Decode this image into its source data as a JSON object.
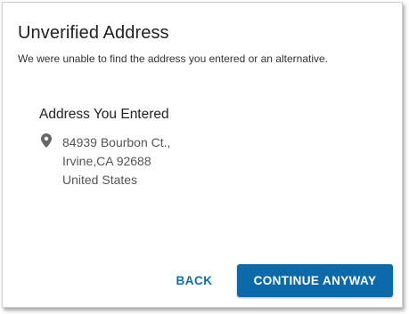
{
  "dialog": {
    "title": "Unverified Address",
    "subtitle": "We were unable to find the address you entered or an alternative."
  },
  "address": {
    "heading": "Address You Entered",
    "icon": "map-pin-icon",
    "line1": "84939 Bourbon Ct.,",
    "line2": "Irvine,CA 92688",
    "line3": "United States"
  },
  "actions": {
    "back_label": "BACK",
    "continue_label": "CONTINUE ANYWAY"
  },
  "colors": {
    "accent": "#0c6aab",
    "link": "#0b6fb0",
    "icon": "#666666"
  }
}
